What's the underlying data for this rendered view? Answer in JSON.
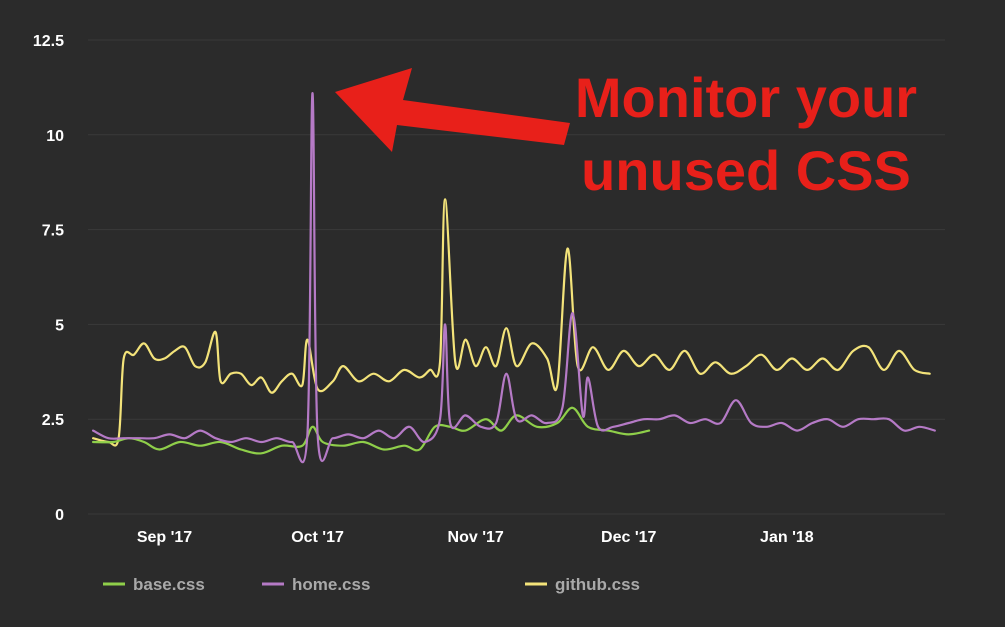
{
  "colors": {
    "background": "#2b2b2b",
    "grid": "#3a3a3a",
    "tick_text": "#ffffff",
    "legend_text": "#a9a9a9",
    "annotation": "#e8201a",
    "base": "#8fcf4a",
    "home": "#b57ac6",
    "github": "#f3e37a"
  },
  "annotation": {
    "line1": "Monitor your",
    "line2": "unused CSS"
  },
  "chart_data": {
    "type": "line",
    "title": "",
    "xlabel": "",
    "ylabel": "",
    "ylim": [
      0,
      12.5
    ],
    "yticks": [
      0,
      2.5,
      5,
      7.5,
      10,
      12.5
    ],
    "ytick_labels": [
      "0",
      "2.5",
      "5",
      "7.5",
      "10",
      "12.5"
    ],
    "xlim": [
      "2017-08-17",
      "2018-02-01"
    ],
    "xticks": [
      "2017-09-01",
      "2017-10-01",
      "2017-11-01",
      "2017-12-01",
      "2018-01-01"
    ],
    "xtick_labels": [
      "Sep '17",
      "Oct '17",
      "Nov '17",
      "Dec '17",
      "Jan '18"
    ],
    "grid": "horizontal",
    "legend_position": "bottom",
    "series": [
      {
        "name": "base.css",
        "color": "#8fcf4a",
        "points": [
          [
            "2017-08-18",
            1.9
          ],
          [
            "2017-08-22",
            1.9
          ],
          [
            "2017-08-25",
            2.0
          ],
          [
            "2017-08-28",
            1.9
          ],
          [
            "2017-08-31",
            1.7
          ],
          [
            "2017-09-04",
            1.9
          ],
          [
            "2017-09-08",
            1.8
          ],
          [
            "2017-09-12",
            1.9
          ],
          [
            "2017-09-16",
            1.7
          ],
          [
            "2017-09-20",
            1.6
          ],
          [
            "2017-09-24",
            1.8
          ],
          [
            "2017-09-28",
            1.8
          ],
          [
            "2017-09-30",
            2.3
          ],
          [
            "2017-10-02",
            1.9
          ],
          [
            "2017-10-06",
            1.8
          ],
          [
            "2017-10-10",
            1.9
          ],
          [
            "2017-10-14",
            1.7
          ],
          [
            "2017-10-18",
            1.8
          ],
          [
            "2017-10-21",
            1.7
          ],
          [
            "2017-10-24",
            2.3
          ],
          [
            "2017-10-27",
            2.3
          ],
          [
            "2017-10-30",
            2.2
          ],
          [
            "2017-11-03",
            2.5
          ],
          [
            "2017-11-06",
            2.2
          ],
          [
            "2017-11-09",
            2.6
          ],
          [
            "2017-11-13",
            2.3
          ],
          [
            "2017-11-17",
            2.4
          ],
          [
            "2017-11-20",
            2.8
          ],
          [
            "2017-11-23",
            2.3
          ],
          [
            "2017-11-27",
            2.2
          ],
          [
            "2017-12-01",
            2.1
          ],
          [
            "2017-12-05",
            2.2
          ]
        ]
      },
      {
        "name": "home.css",
        "color": "#b57ac6",
        "points": [
          [
            "2017-08-18",
            2.2
          ],
          [
            "2017-08-21",
            2.0
          ],
          [
            "2017-08-24",
            2.0
          ],
          [
            "2017-08-27",
            2.0
          ],
          [
            "2017-08-30",
            2.0
          ],
          [
            "2017-09-02",
            2.1
          ],
          [
            "2017-09-05",
            2.0
          ],
          [
            "2017-09-08",
            2.2
          ],
          [
            "2017-09-11",
            2.0
          ],
          [
            "2017-09-14",
            1.9
          ],
          [
            "2017-09-17",
            2.0
          ],
          [
            "2017-09-20",
            1.9
          ],
          [
            "2017-09-23",
            2.0
          ],
          [
            "2017-09-26",
            1.9
          ],
          [
            "2017-09-29",
            2.1
          ],
          [
            "2017-09-30",
            11.1
          ],
          [
            "2017-10-01",
            2.1
          ],
          [
            "2017-10-04",
            2.0
          ],
          [
            "2017-10-07",
            2.1
          ],
          [
            "2017-10-10",
            2.0
          ],
          [
            "2017-10-13",
            2.2
          ],
          [
            "2017-10-16",
            2.0
          ],
          [
            "2017-10-19",
            2.3
          ],
          [
            "2017-10-22",
            1.9
          ],
          [
            "2017-10-25",
            2.5
          ],
          [
            "2017-10-26",
            5.0
          ],
          [
            "2017-10-27",
            2.4
          ],
          [
            "2017-10-30",
            2.6
          ],
          [
            "2017-11-02",
            2.3
          ],
          [
            "2017-11-05",
            2.4
          ],
          [
            "2017-11-07",
            3.7
          ],
          [
            "2017-11-09",
            2.5
          ],
          [
            "2017-11-12",
            2.6
          ],
          [
            "2017-11-15",
            2.4
          ],
          [
            "2017-11-18",
            2.8
          ],
          [
            "2017-11-20",
            5.3
          ],
          [
            "2017-11-22",
            2.6
          ],
          [
            "2017-11-23",
            3.6
          ],
          [
            "2017-11-25",
            2.3
          ],
          [
            "2017-11-28",
            2.3
          ],
          [
            "2017-12-01",
            2.4
          ],
          [
            "2017-12-04",
            2.5
          ],
          [
            "2017-12-07",
            2.5
          ],
          [
            "2017-12-10",
            2.6
          ],
          [
            "2017-12-13",
            2.4
          ],
          [
            "2017-12-16",
            2.5
          ],
          [
            "2017-12-19",
            2.4
          ],
          [
            "2017-12-22",
            3.0
          ],
          [
            "2017-12-25",
            2.4
          ],
          [
            "2017-12-28",
            2.3
          ],
          [
            "2017-12-31",
            2.4
          ],
          [
            "2018-01-03",
            2.2
          ],
          [
            "2018-01-06",
            2.4
          ],
          [
            "2018-01-09",
            2.5
          ],
          [
            "2018-01-12",
            2.3
          ],
          [
            "2018-01-15",
            2.5
          ],
          [
            "2018-01-18",
            2.5
          ],
          [
            "2018-01-21",
            2.5
          ],
          [
            "2018-01-24",
            2.2
          ],
          [
            "2018-01-27",
            2.3
          ],
          [
            "2018-01-30",
            2.2
          ]
        ]
      },
      {
        "name": "github.css",
        "color": "#f3e37a",
        "points": [
          [
            "2017-08-18",
            2.0
          ],
          [
            "2017-08-21",
            1.9
          ],
          [
            "2017-08-23",
            2.0
          ],
          [
            "2017-08-24",
            4.1
          ],
          [
            "2017-08-26",
            4.2
          ],
          [
            "2017-08-28",
            4.5
          ],
          [
            "2017-08-30",
            4.1
          ],
          [
            "2017-09-01",
            4.1
          ],
          [
            "2017-09-03",
            4.3
          ],
          [
            "2017-09-05",
            4.4
          ],
          [
            "2017-09-07",
            3.9
          ],
          [
            "2017-09-09",
            4.0
          ],
          [
            "2017-09-11",
            4.8
          ],
          [
            "2017-09-12",
            3.5
          ],
          [
            "2017-09-14",
            3.7
          ],
          [
            "2017-09-16",
            3.7
          ],
          [
            "2017-09-18",
            3.4
          ],
          [
            "2017-09-20",
            3.6
          ],
          [
            "2017-09-22",
            3.2
          ],
          [
            "2017-09-24",
            3.5
          ],
          [
            "2017-09-26",
            3.7
          ],
          [
            "2017-09-28",
            3.4
          ],
          [
            "2017-09-29",
            4.6
          ],
          [
            "2017-10-01",
            3.3
          ],
          [
            "2017-10-04",
            3.5
          ],
          [
            "2017-10-06",
            3.9
          ],
          [
            "2017-10-09",
            3.5
          ],
          [
            "2017-10-12",
            3.7
          ],
          [
            "2017-10-15",
            3.5
          ],
          [
            "2017-10-18",
            3.8
          ],
          [
            "2017-10-21",
            3.6
          ],
          [
            "2017-10-23",
            3.8
          ],
          [
            "2017-10-25",
            4.0
          ],
          [
            "2017-10-26",
            8.3
          ],
          [
            "2017-10-28",
            4.0
          ],
          [
            "2017-10-30",
            4.6
          ],
          [
            "2017-11-01",
            3.9
          ],
          [
            "2017-11-03",
            4.4
          ],
          [
            "2017-11-05",
            3.9
          ],
          [
            "2017-11-07",
            4.9
          ],
          [
            "2017-11-09",
            3.9
          ],
          [
            "2017-11-12",
            4.5
          ],
          [
            "2017-11-15",
            4.1
          ],
          [
            "2017-11-17",
            3.4
          ],
          [
            "2017-11-19",
            7.0
          ],
          [
            "2017-11-21",
            3.9
          ],
          [
            "2017-11-24",
            4.4
          ],
          [
            "2017-11-27",
            3.8
          ],
          [
            "2017-11-30",
            4.3
          ],
          [
            "2017-12-03",
            3.9
          ],
          [
            "2017-12-06",
            4.2
          ],
          [
            "2017-12-09",
            3.8
          ],
          [
            "2017-12-12",
            4.3
          ],
          [
            "2017-12-15",
            3.7
          ],
          [
            "2017-12-18",
            4.0
          ],
          [
            "2017-12-21",
            3.7
          ],
          [
            "2017-12-24",
            3.9
          ],
          [
            "2017-12-27",
            4.2
          ],
          [
            "2017-12-30",
            3.8
          ],
          [
            "2018-01-02",
            4.1
          ],
          [
            "2018-01-05",
            3.8
          ],
          [
            "2018-01-08",
            4.1
          ],
          [
            "2018-01-11",
            3.8
          ],
          [
            "2018-01-14",
            4.3
          ],
          [
            "2018-01-17",
            4.4
          ],
          [
            "2018-01-20",
            3.8
          ],
          [
            "2018-01-23",
            4.3
          ],
          [
            "2018-01-26",
            3.8
          ],
          [
            "2018-01-29",
            3.7
          ]
        ]
      }
    ]
  }
}
